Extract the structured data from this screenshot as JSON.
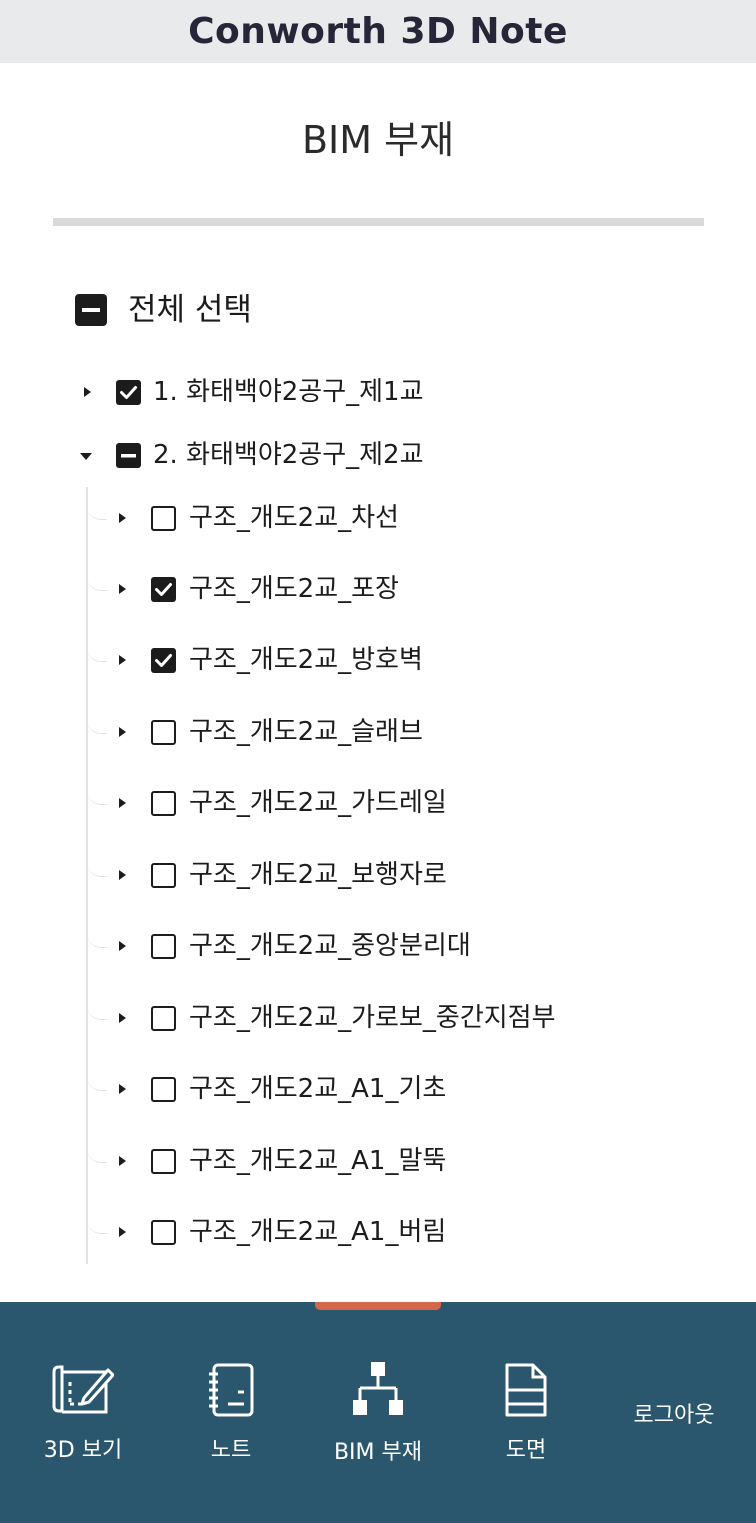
{
  "app": {
    "title": "Conworth 3D Note"
  },
  "page": {
    "title": "BIM 부재"
  },
  "tree": {
    "select_all": {
      "label": "전체 선택",
      "state": "indeterminate"
    },
    "groups": [
      {
        "label": "1. 화태백야2공구_제1교",
        "state": "checked",
        "expanded": false
      },
      {
        "label": "2. 화태백야2공구_제2교",
        "state": "indeterminate",
        "expanded": true
      }
    ],
    "children": [
      {
        "label": "구조_개도2교_차선",
        "state": "unchecked"
      },
      {
        "label": "구조_개도2교_포장",
        "state": "checked"
      },
      {
        "label": "구조_개도2교_방호벽",
        "state": "checked"
      },
      {
        "label": "구조_개도2교_슬래브",
        "state": "unchecked"
      },
      {
        "label": "구조_개도2교_가드레일",
        "state": "unchecked"
      },
      {
        "label": "구조_개도2교_보행자로",
        "state": "unchecked"
      },
      {
        "label": "구조_개도2교_중앙분리대",
        "state": "unchecked"
      },
      {
        "label": "구조_개도2교_가로보_중간지점부",
        "state": "unchecked"
      },
      {
        "label": "구조_개도2교_A1_기초",
        "state": "unchecked"
      },
      {
        "label": "구조_개도2교_A1_말뚝",
        "state": "unchecked"
      },
      {
        "label": "구조_개도2교_A1_버림",
        "state": "unchecked"
      }
    ]
  },
  "nav": {
    "items": [
      {
        "label": "3D 보기",
        "icon": "blueprint-pencil-icon"
      },
      {
        "label": "노트",
        "icon": "notebook-icon"
      },
      {
        "label": "BIM 부재",
        "icon": "hierarchy-icon",
        "active": true
      },
      {
        "label": "도면",
        "icon": "document-icon"
      },
      {
        "label": "로그아웃",
        "icon": ""
      }
    ]
  },
  "colors": {
    "nav_background": "#2a576d",
    "active_indicator": "#d4674b",
    "topbar_background": "#e8eaeb"
  }
}
